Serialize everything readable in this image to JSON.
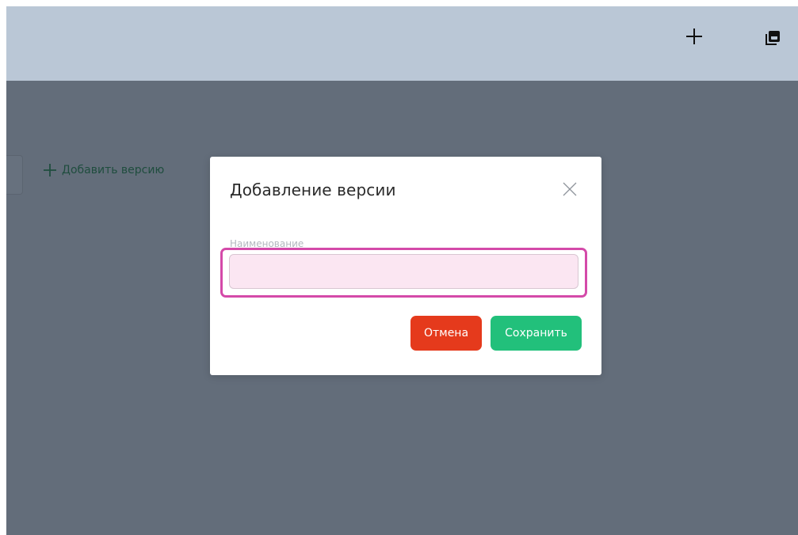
{
  "toolbar": {
    "add_icon": "plus-icon",
    "copy_icon": "copy-icon"
  },
  "background": {
    "add_version_label": "Добавить версию",
    "add_version_color": "#1f4d3e"
  },
  "modal": {
    "title": "Добавление версии",
    "close_icon": "close-icon",
    "field": {
      "label": "Наименование",
      "value": "",
      "placeholder": ""
    },
    "buttons": {
      "cancel_label": "Отмена",
      "save_label": "Сохранить"
    }
  },
  "colors": {
    "topbar": "#bac7d6",
    "overlay": "#636d7a",
    "cancel": "#e53a1c",
    "save": "#22c07b",
    "highlight": "#d44aa9",
    "input_bg": "#fbe6f2"
  }
}
